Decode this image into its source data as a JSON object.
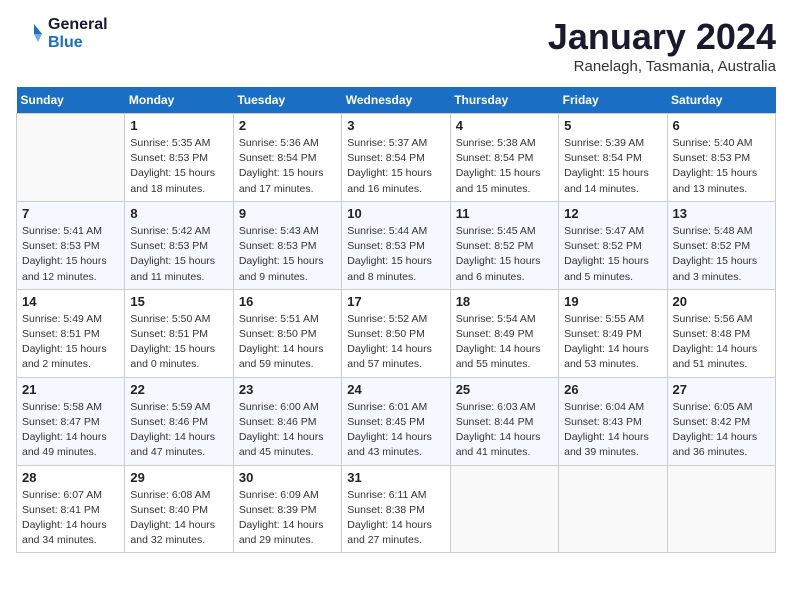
{
  "logo": {
    "line1": "General",
    "line2": "Blue"
  },
  "title": "January 2024",
  "subtitle": "Ranelagh, Tasmania, Australia",
  "days_of_week": [
    "Sunday",
    "Monday",
    "Tuesday",
    "Wednesday",
    "Thursday",
    "Friday",
    "Saturday"
  ],
  "weeks": [
    [
      {
        "day": "",
        "empty": true
      },
      {
        "day": "1",
        "sunrise": "5:35 AM",
        "sunset": "8:53 PM",
        "daylight": "15 hours and 18 minutes."
      },
      {
        "day": "2",
        "sunrise": "5:36 AM",
        "sunset": "8:54 PM",
        "daylight": "15 hours and 17 minutes."
      },
      {
        "day": "3",
        "sunrise": "5:37 AM",
        "sunset": "8:54 PM",
        "daylight": "15 hours and 16 minutes."
      },
      {
        "day": "4",
        "sunrise": "5:38 AM",
        "sunset": "8:54 PM",
        "daylight": "15 hours and 15 minutes."
      },
      {
        "day": "5",
        "sunrise": "5:39 AM",
        "sunset": "8:54 PM",
        "daylight": "15 hours and 14 minutes."
      },
      {
        "day": "6",
        "sunrise": "5:40 AM",
        "sunset": "8:53 PM",
        "daylight": "15 hours and 13 minutes."
      }
    ],
    [
      {
        "day": "7",
        "sunrise": "5:41 AM",
        "sunset": "8:53 PM",
        "daylight": "15 hours and 12 minutes."
      },
      {
        "day": "8",
        "sunrise": "5:42 AM",
        "sunset": "8:53 PM",
        "daylight": "15 hours and 11 minutes."
      },
      {
        "day": "9",
        "sunrise": "5:43 AM",
        "sunset": "8:53 PM",
        "daylight": "15 hours and 9 minutes."
      },
      {
        "day": "10",
        "sunrise": "5:44 AM",
        "sunset": "8:53 PM",
        "daylight": "15 hours and 8 minutes."
      },
      {
        "day": "11",
        "sunrise": "5:45 AM",
        "sunset": "8:52 PM",
        "daylight": "15 hours and 6 minutes."
      },
      {
        "day": "12",
        "sunrise": "5:47 AM",
        "sunset": "8:52 PM",
        "daylight": "15 hours and 5 minutes."
      },
      {
        "day": "13",
        "sunrise": "5:48 AM",
        "sunset": "8:52 PM",
        "daylight": "15 hours and 3 minutes."
      }
    ],
    [
      {
        "day": "14",
        "sunrise": "5:49 AM",
        "sunset": "8:51 PM",
        "daylight": "15 hours and 2 minutes."
      },
      {
        "day": "15",
        "sunrise": "5:50 AM",
        "sunset": "8:51 PM",
        "daylight": "15 hours and 0 minutes."
      },
      {
        "day": "16",
        "sunrise": "5:51 AM",
        "sunset": "8:50 PM",
        "daylight": "14 hours and 59 minutes."
      },
      {
        "day": "17",
        "sunrise": "5:52 AM",
        "sunset": "8:50 PM",
        "daylight": "14 hours and 57 minutes."
      },
      {
        "day": "18",
        "sunrise": "5:54 AM",
        "sunset": "8:49 PM",
        "daylight": "14 hours and 55 minutes."
      },
      {
        "day": "19",
        "sunrise": "5:55 AM",
        "sunset": "8:49 PM",
        "daylight": "14 hours and 53 minutes."
      },
      {
        "day": "20",
        "sunrise": "5:56 AM",
        "sunset": "8:48 PM",
        "daylight": "14 hours and 51 minutes."
      }
    ],
    [
      {
        "day": "21",
        "sunrise": "5:58 AM",
        "sunset": "8:47 PM",
        "daylight": "14 hours and 49 minutes."
      },
      {
        "day": "22",
        "sunrise": "5:59 AM",
        "sunset": "8:46 PM",
        "daylight": "14 hours and 47 minutes."
      },
      {
        "day": "23",
        "sunrise": "6:00 AM",
        "sunset": "8:46 PM",
        "daylight": "14 hours and 45 minutes."
      },
      {
        "day": "24",
        "sunrise": "6:01 AM",
        "sunset": "8:45 PM",
        "daylight": "14 hours and 43 minutes."
      },
      {
        "day": "25",
        "sunrise": "6:03 AM",
        "sunset": "8:44 PM",
        "daylight": "14 hours and 41 minutes."
      },
      {
        "day": "26",
        "sunrise": "6:04 AM",
        "sunset": "8:43 PM",
        "daylight": "14 hours and 39 minutes."
      },
      {
        "day": "27",
        "sunrise": "6:05 AM",
        "sunset": "8:42 PM",
        "daylight": "14 hours and 36 minutes."
      }
    ],
    [
      {
        "day": "28",
        "sunrise": "6:07 AM",
        "sunset": "8:41 PM",
        "daylight": "14 hours and 34 minutes."
      },
      {
        "day": "29",
        "sunrise": "6:08 AM",
        "sunset": "8:40 PM",
        "daylight": "14 hours and 32 minutes."
      },
      {
        "day": "30",
        "sunrise": "6:09 AM",
        "sunset": "8:39 PM",
        "daylight": "14 hours and 29 minutes."
      },
      {
        "day": "31",
        "sunrise": "6:11 AM",
        "sunset": "8:38 PM",
        "daylight": "14 hours and 27 minutes."
      },
      {
        "day": "",
        "empty": true
      },
      {
        "day": "",
        "empty": true
      },
      {
        "day": "",
        "empty": true
      }
    ]
  ]
}
